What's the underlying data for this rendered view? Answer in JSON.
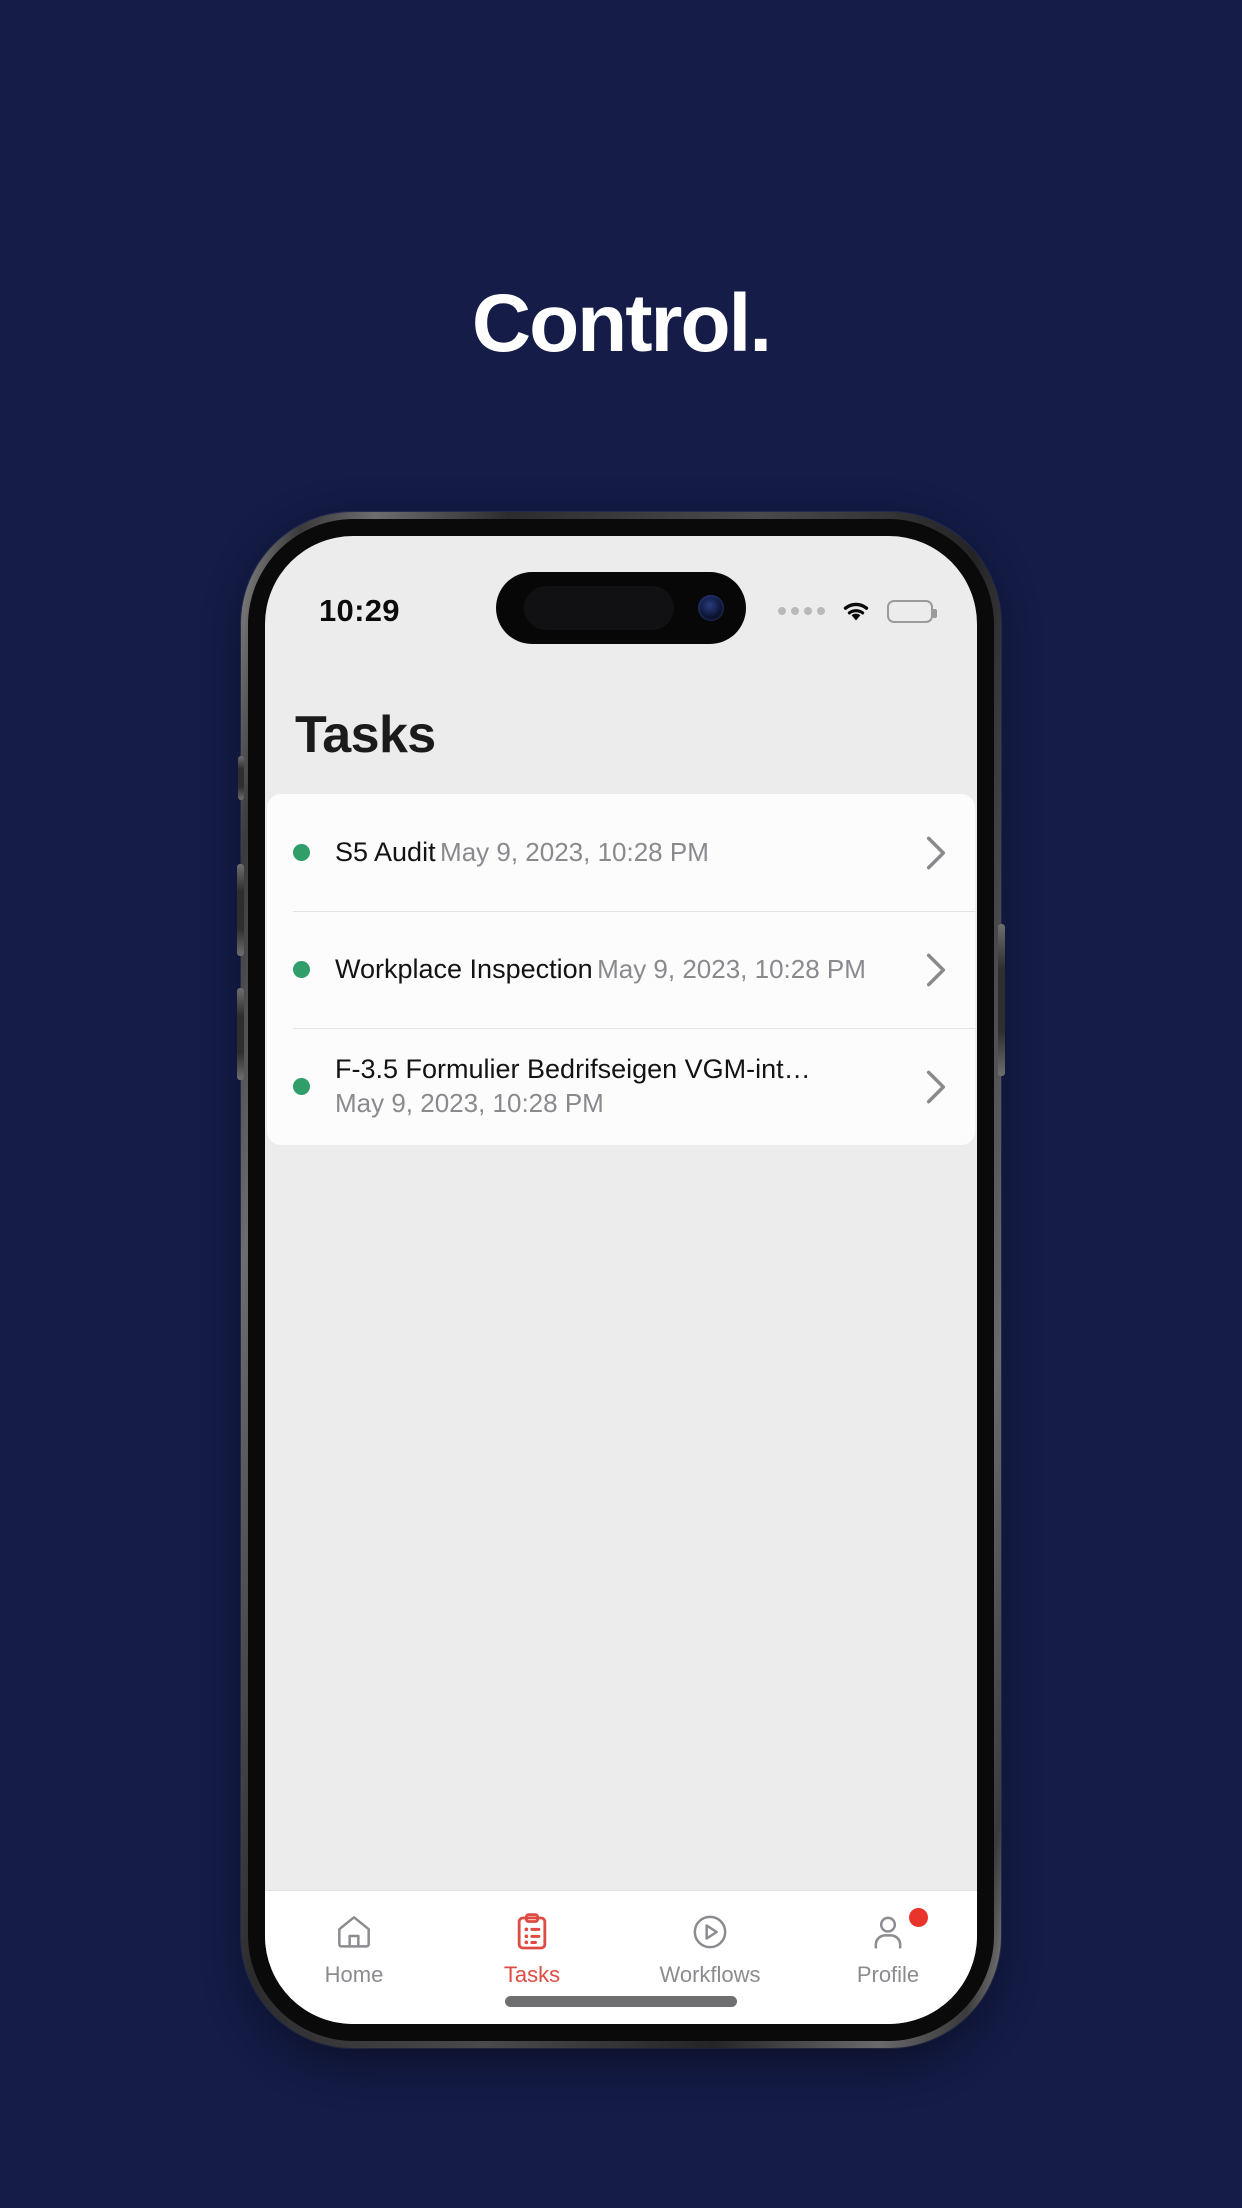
{
  "hero": {
    "headline": "Control.",
    "background_color": "#141C47"
  },
  "phone": {
    "status_bar": {
      "time": "10:29",
      "cellular_icon": "cellular-dots-icon",
      "wifi_icon": "wifi-icon",
      "battery_icon": "battery-full-icon"
    },
    "screen": {
      "background_color": "#ECECEC",
      "page_title": "Tasks",
      "tasks": [
        {
          "status_color": "#2F9E69",
          "title": "S5 Audit",
          "date": "May 9, 2023, 10:28 PM",
          "chevron": "chevron-right-icon"
        },
        {
          "status_color": "#2F9E69",
          "title": "Workplace Inspection",
          "date": "May 9, 2023, 10:28 PM",
          "chevron": "chevron-right-icon"
        },
        {
          "status_color": "#2F9E69",
          "title": "F-3.5 Formulier Bedrifseigen VGM-int…",
          "date": "May 9, 2023, 10:28 PM",
          "chevron": "chevron-right-icon"
        }
      ],
      "tab_bar": {
        "active_color": "#DE4B42",
        "inactive_color": "#8C8C90",
        "badge_color": "#E8342B",
        "tabs": [
          {
            "label": "Home",
            "icon": "home-icon",
            "active": false,
            "badge": false
          },
          {
            "label": "Tasks",
            "icon": "clipboard-list-icon",
            "active": true,
            "badge": false
          },
          {
            "label": "Workflows",
            "icon": "play-circle-icon",
            "active": false,
            "badge": false
          },
          {
            "label": "Profile",
            "icon": "person-icon",
            "active": false,
            "badge": true
          }
        ]
      }
    }
  }
}
